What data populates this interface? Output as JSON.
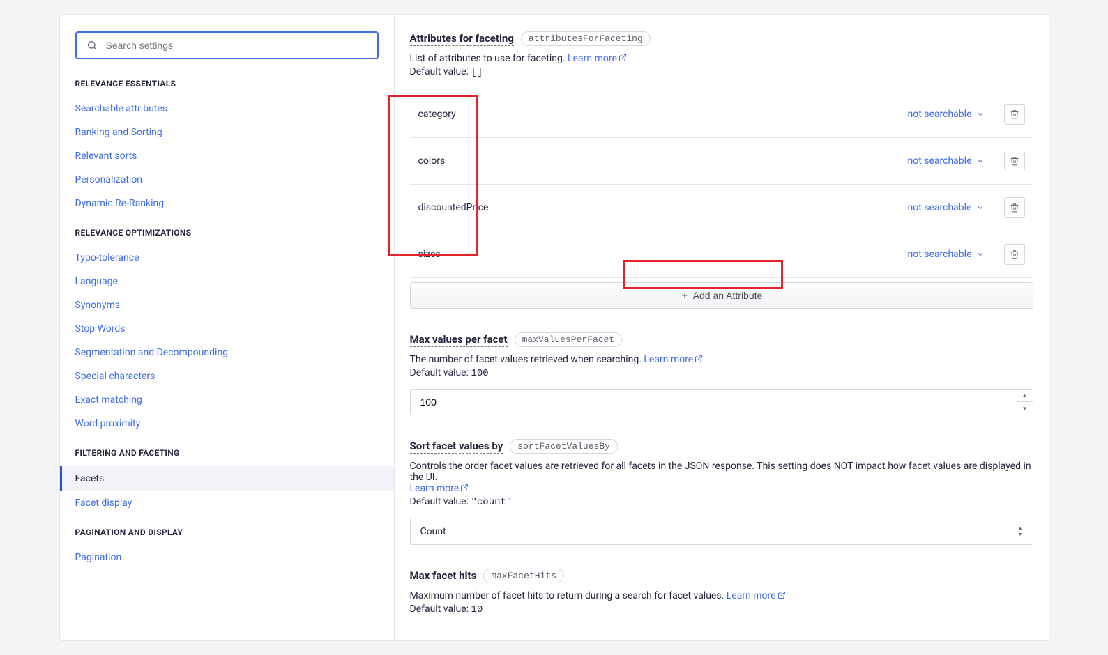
{
  "search": {
    "placeholder": "Search settings"
  },
  "nav": {
    "groups": [
      {
        "title": "RELEVANCE ESSENTIALS",
        "items": [
          {
            "label": "Searchable attributes",
            "active": false
          },
          {
            "label": "Ranking and Sorting",
            "active": false
          },
          {
            "label": "Relevant sorts",
            "active": false
          },
          {
            "label": "Personalization",
            "active": false
          },
          {
            "label": "Dynamic Re-Ranking",
            "active": false
          }
        ]
      },
      {
        "title": "RELEVANCE OPTIMIZATIONS",
        "items": [
          {
            "label": "Typo-tolerance",
            "active": false
          },
          {
            "label": "Language",
            "active": false
          },
          {
            "label": "Synonyms",
            "active": false
          },
          {
            "label": "Stop Words",
            "active": false
          },
          {
            "label": "Segmentation and Decompounding",
            "active": false
          },
          {
            "label": "Special characters",
            "active": false
          },
          {
            "label": "Exact matching",
            "active": false
          },
          {
            "label": "Word proximity",
            "active": false
          }
        ]
      },
      {
        "title": "FILTERING AND FACETING",
        "items": [
          {
            "label": "Facets",
            "active": true
          },
          {
            "label": "Facet display",
            "active": false
          }
        ]
      },
      {
        "title": "PAGINATION AND DISPLAY",
        "items": [
          {
            "label": "Pagination",
            "active": false
          }
        ]
      }
    ]
  },
  "sections": {
    "attributesForFaceting": {
      "title": "Attributes for faceting",
      "api": "attributesForFaceting",
      "desc": "List of attributes to use for faceting. ",
      "learn": "Learn more",
      "defaultLabel": "Default value: ",
      "defaultValue": "[]",
      "items": [
        {
          "name": "category",
          "mode": "not searchable"
        },
        {
          "name": "colors",
          "mode": "not searchable"
        },
        {
          "name": "discountedPrice",
          "mode": "not searchable"
        },
        {
          "name": "sizes",
          "mode": "not searchable"
        }
      ],
      "addLabel": "Add an Attribute"
    },
    "maxValuesPerFacet": {
      "title": "Max values per facet",
      "api": "maxValuesPerFacet",
      "desc": "The number of facet values retrieved when searching. ",
      "learn": "Learn more",
      "defaultLabel": "Default value: ",
      "defaultValue": "100",
      "value": "100"
    },
    "sortFacetValuesBy": {
      "title": "Sort facet values by",
      "api": "sortFacetValuesBy",
      "desc": "Controls the order facet values are retrieved for all facets in the JSON response. This setting does NOT impact how facet values are displayed in the UI. ",
      "learn": "Learn more",
      "defaultLabel": "Default value: ",
      "defaultValue": "\"count\"",
      "value": "Count"
    },
    "maxFacetHits": {
      "title": "Max facet hits",
      "api": "maxFacetHits",
      "desc": "Maximum number of facet hits to return during a search for facet values. ",
      "learn": "Learn more",
      "defaultLabel": "Default value: ",
      "defaultValue": "10"
    }
  }
}
